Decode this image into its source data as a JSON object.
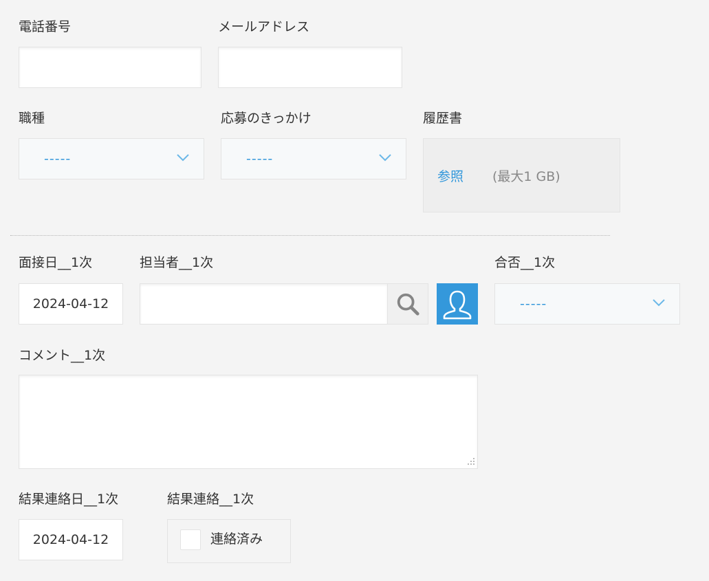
{
  "fields": {
    "phone": {
      "label": "電話番号",
      "value": ""
    },
    "email": {
      "label": "メールアドレス",
      "value": ""
    },
    "job_type": {
      "label": "職種",
      "value": "-----"
    },
    "source": {
      "label": "応募のきっかけ",
      "value": "-----"
    },
    "resume": {
      "label": "履歴書",
      "browse_label": "参照",
      "limit_text": "(最大1 GB)"
    },
    "interview_date_1": {
      "label": "面接日__1次",
      "value": "2024-04-12"
    },
    "interviewer_1": {
      "label": "担当者__1次",
      "value": ""
    },
    "result_1": {
      "label": "合否__1次",
      "value": "-----"
    },
    "comment_1": {
      "label": "コメント__1次",
      "value": ""
    },
    "result_notice_date_1": {
      "label": "結果連絡日__1次",
      "value": "2024-04-12"
    },
    "result_notice_1": {
      "label": "結果連絡__1次",
      "option_label": "連絡済み",
      "checked": false
    }
  },
  "icons": {
    "search": "search-icon",
    "user": "user-icon",
    "dropdown": "chevron-down-icon"
  },
  "colors": {
    "background": "#f4f4f4",
    "accent": "#3498db",
    "text": "#333333",
    "muted": "#888888"
  }
}
